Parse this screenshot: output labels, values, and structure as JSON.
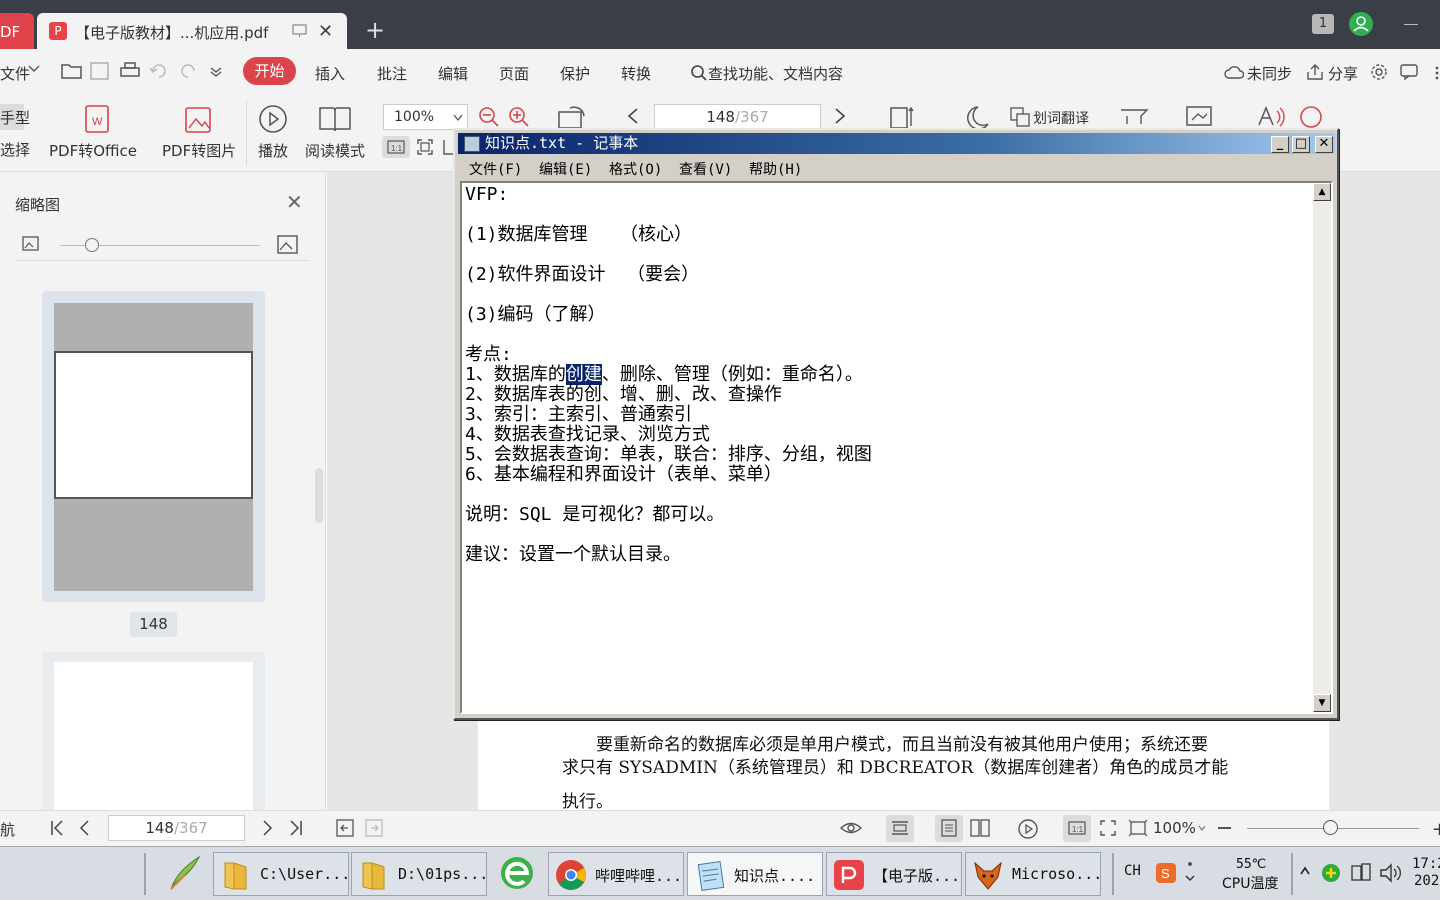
{
  "tabbar": {
    "app_badge": "DF",
    "doc_tab_title": "【电子版教材】...机应用.pdf",
    "new_tab": "+",
    "window_badge": "1"
  },
  "menubar": {
    "file": "文件",
    "start": "开始",
    "items": [
      "插入",
      "批注",
      "编辑",
      "页面",
      "保护",
      "转换"
    ],
    "search_placeholder": "查找功能、文档内容",
    "sync": "未同步",
    "share": "分享"
  },
  "ribbon": {
    "left_cut_1": "手型",
    "left_cut_2": "选择",
    "pdf_to_office": "PDF转Office",
    "pdf_to_image": "PDF转图片",
    "play": "播放",
    "read_mode": "阅读模式",
    "zoom": "100%",
    "page_current": "148",
    "page_total": "/367",
    "translate": "划词翻译"
  },
  "leftpanel": {
    "title": "缩略图",
    "page_label": "148"
  },
  "document": {
    "lines": [
      "要重新命名的数据库必须是单用户模式，而且当前没有被其他用户使用；系统还要",
      "求只有 SYSADMIN（系统管理员）和 DBCREATOR（数据库创建者）角色的成员才能",
      "执行。"
    ]
  },
  "statusbar": {
    "nav": "航",
    "page_current": "148",
    "page_total": "/367",
    "zoom": "100%"
  },
  "notepad": {
    "title": "知识点.txt - 记事本",
    "menu": [
      "文件(F)",
      "编辑(E)",
      "格式(O)",
      "查看(V)",
      "帮助(H)"
    ],
    "text_before_selection": "VFP:\n\n(1)数据库管理   （核心）\n\n(2)软件界面设计  （要会）\n\n(3)编码（了解）\n\n考点:\n1、数据库的",
    "selected_text": "创建",
    "text_after_selection": "、删除、管理（例如：重命名）。\n2、数据库表的创、增、删、改、查操作\n3、索引：主索引、普通索引\n4、数据表查找记录、浏览方式\n5、会数据表查询：单表，联合：排序、分组，视图\n6、基本编程和界面设计（表单、菜单）\n\n说明：SQL 是可视化？都可以。\n\n建议：设置一个默认目录。"
  },
  "taskbar": {
    "items": [
      {
        "label": "C:\\User...",
        "icon": "folder-icon"
      },
      {
        "label": "D:\\01ps...",
        "icon": "folder-icon"
      },
      {
        "label": "哔哩哔哩...",
        "icon": "chrome-icon"
      },
      {
        "label": "知识点....",
        "icon": "notepad-icon"
      },
      {
        "label": "【电子版...",
        "icon": "pdf-icon"
      },
      {
        "label": "Microso...",
        "icon": "foxpro-icon"
      }
    ],
    "lang": "CH",
    "temp": "55℃",
    "temp_label": "CPU温度",
    "time": "17:2",
    "date": "202"
  }
}
